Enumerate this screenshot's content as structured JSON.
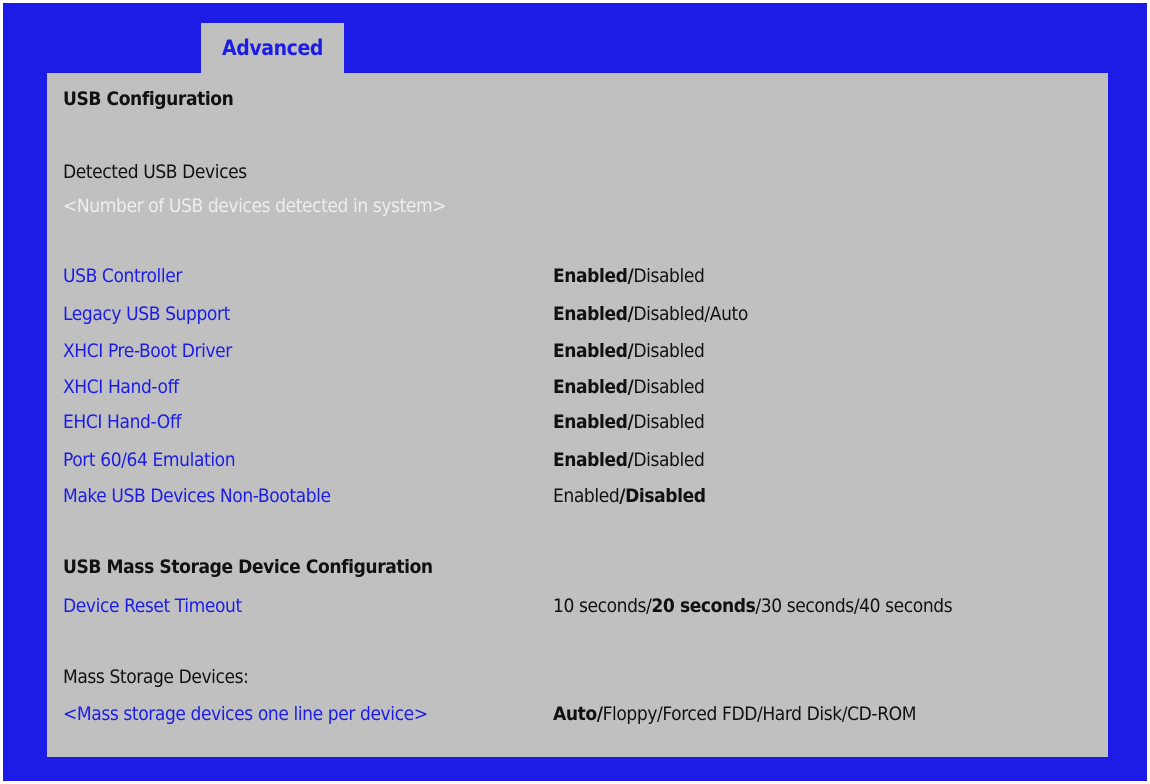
{
  "tab": {
    "label": "Advanced"
  },
  "section_title": "USB Configuration",
  "detected": {
    "label": "Detected USB Devices",
    "placeholder": "<Number of USB devices detected in system>"
  },
  "settings": [
    {
      "label": "USB Controller",
      "parts": [
        {
          "text": "Enabled",
          "bold": true
        },
        {
          "text": "/",
          "bold": true
        },
        {
          "text": "Disabled",
          "bold": false
        }
      ]
    },
    {
      "label": "Legacy USB Support",
      "parts": [
        {
          "text": "Enabled",
          "bold": true
        },
        {
          "text": "/",
          "bold": true
        },
        {
          "text": "Disabled/Auto",
          "bold": false
        }
      ]
    },
    {
      "label": "XHCI Pre-Boot Driver",
      "parts": [
        {
          "text": "Enabled",
          "bold": true
        },
        {
          "text": "/",
          "bold": true
        },
        {
          "text": "Disabled",
          "bold": false
        }
      ]
    },
    {
      "label": "XHCI Hand-off",
      "parts": [
        {
          "text": "Enabled",
          "bold": true
        },
        {
          "text": "/",
          "bold": true
        },
        {
          "text": "Disabled",
          "bold": false
        }
      ]
    },
    {
      "label": "EHCI Hand-Off",
      "parts": [
        {
          "text": "Enabled",
          "bold": true
        },
        {
          "text": "/",
          "bold": true
        },
        {
          "text": "Disabled",
          "bold": false
        }
      ]
    },
    {
      "label": "Port 60/64 Emulation",
      "parts": [
        {
          "text": "Enabled",
          "bold": true
        },
        {
          "text": "/",
          "bold": true
        },
        {
          "text": "Disabled",
          "bold": false
        }
      ]
    },
    {
      "label": "Make USB Devices Non-Bootable",
      "parts": [
        {
          "text": "Enabled",
          "bold": false
        },
        {
          "text": "/",
          "bold": true
        },
        {
          "text": "Disabled",
          "bold": true
        }
      ]
    }
  ],
  "mass_storage_section": {
    "title": "USB Mass Storage Device Configuration",
    "setting": {
      "label": "Device Reset Timeout",
      "parts": [
        {
          "text": "10 seconds/",
          "bold": false
        },
        {
          "text": "20 seconds",
          "bold": true
        },
        {
          "text": "/30 seconds/40 seconds",
          "bold": false
        }
      ]
    }
  },
  "mass_devices": {
    "label": "Mass Storage Devices:",
    "placeholder": "<Mass storage devices one line per device>",
    "parts": [
      {
        "text": "Auto",
        "bold": true
      },
      {
        "text": "/",
        "bold": true
      },
      {
        "text": "Floppy/Forced FDD/Hard Disk/CD-ROM",
        "bold": false
      }
    ]
  },
  "colors": {
    "frame": "#1c1ce6",
    "panel": "#c0c0c0",
    "setting_label": "#1c1ce6",
    "muted_text": "#eeeeee",
    "text": "#111111"
  }
}
